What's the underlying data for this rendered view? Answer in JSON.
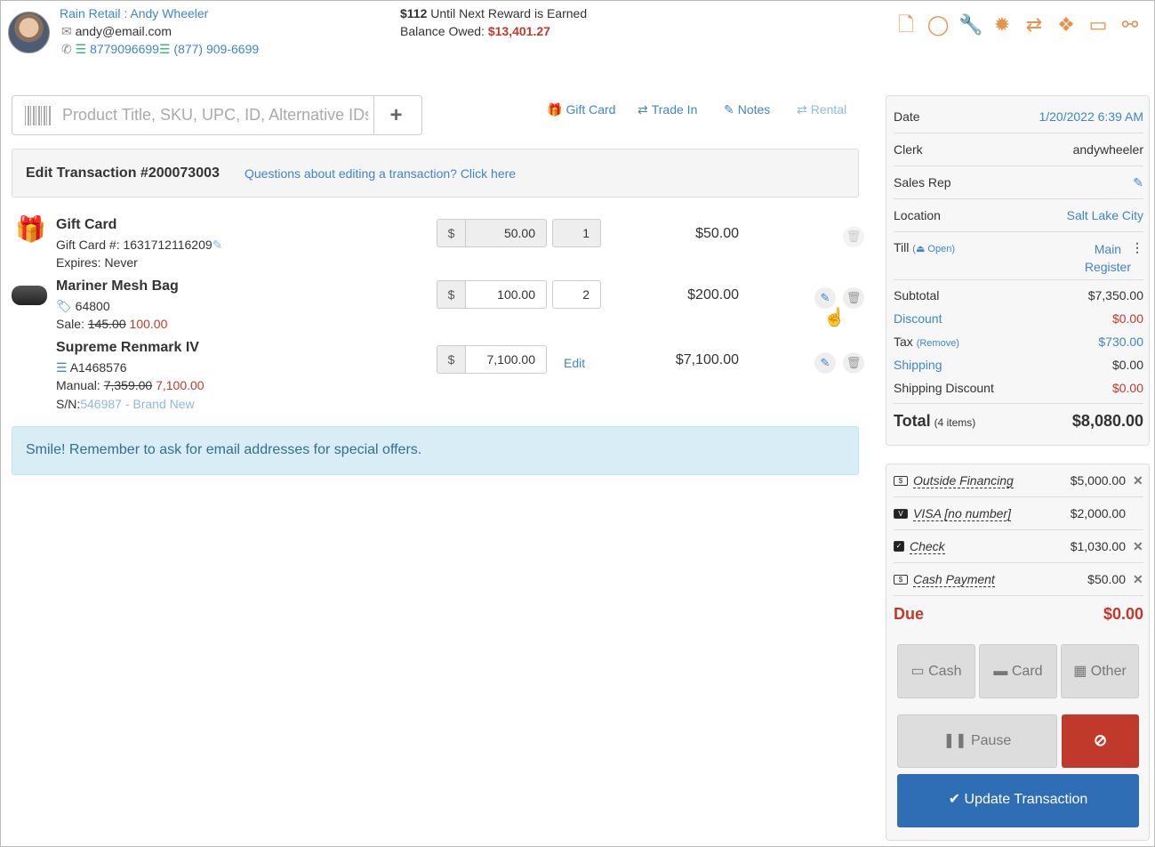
{
  "customer": {
    "store": "Rain Retail",
    "separator": " : ",
    "name": "Andy Wheeler",
    "email": "andy@email.com",
    "phone1": "8779096699",
    "phone2": "(877) 909-6699"
  },
  "rewards": {
    "amount": "$112",
    "text": "Until Next Reward is Earned",
    "balance_label": "Balance Owed: ",
    "balance_value": "$13,401.27"
  },
  "header_icons": [
    "document-icon",
    "chat-icon",
    "wrench-icon",
    "badge-icon",
    "transfer-icon",
    "dropbox-icon",
    "ticket-icon",
    "handshake-icon"
  ],
  "search": {
    "placeholder": "Product Title, SKU, UPC, ID, Alternative IDs",
    "add": "+"
  },
  "tools": {
    "gift_card": "Gift Card",
    "trade_in": "Trade In",
    "notes": "Notes",
    "rental": "Rental"
  },
  "edit": {
    "title": "Edit Transaction #200073003",
    "question": "Questions about editing a transaction? Click here"
  },
  "items": [
    {
      "title": "Gift Card",
      "line1": "Gift Card #: 1631712116209",
      "line2": "Expires: Never",
      "currency": "$",
      "price": "50.00",
      "qty": "1",
      "total": "$50.00"
    },
    {
      "title": "Mariner Mesh Bag",
      "sku": "64800",
      "sale_label": "Sale: ",
      "old_price": "145.00",
      "new_price": "100.00",
      "currency": "$",
      "price": "100.00",
      "qty": "2",
      "total": "$200.00"
    },
    {
      "title": "Supreme Renmark IV",
      "sku": "A1468576",
      "manual_label": "Manual: ",
      "old_price": "7,359.00",
      "new_price": "7,100.00",
      "sn_label": "S/N:",
      "sn_value": "546987 - Brand New",
      "currency": "$",
      "price": "7,100.00",
      "edit": "Edit",
      "total": "$7,100.00"
    }
  ],
  "info_message": "Smile! Remember to ask for email addresses for special offers.",
  "summary": {
    "date_label": "Date",
    "date_value": "1/20/2022 6:39 AM",
    "clerk_label": "Clerk",
    "clerk_value": "andywheeler",
    "rep_label": "Sales Rep",
    "location_label": "Location",
    "location_value": "Salt Lake City",
    "till_label": "Till",
    "till_status": "Open",
    "till_value1": "Main",
    "till_value2": "Register",
    "subtotal_label": "Subtotal",
    "subtotal_value": "$7,350.00",
    "discount_label": "Discount",
    "discount_value": "$0.00",
    "tax_label": "Tax",
    "tax_remove": "(Remove)",
    "tax_value": "$730.00",
    "shipping_label": "Shipping",
    "shipping_value": "$0.00",
    "ship_disc_label": "Shipping Discount",
    "ship_disc_value": "$0.00",
    "total_label": "Total",
    "total_items": "(4 items)",
    "total_value": "$8,080.00"
  },
  "payments": [
    {
      "name": "Outside Financing",
      "amount": "$5,000.00",
      "icon": "cash-icon"
    },
    {
      "name": "VISA [no number]",
      "amount": "$2,000.00",
      "icon": "visa-icon"
    },
    {
      "name": "Check",
      "amount": "$1,030.00",
      "icon": "check-icon"
    },
    {
      "name": "Cash Payment",
      "amount": "$50.00",
      "icon": "cash-icon"
    }
  ],
  "due": {
    "label": "Due",
    "value": "$0.00"
  },
  "buttons": {
    "cash": "Cash",
    "card": "Card",
    "other": "Other",
    "pause": "Pause",
    "update": "Update Transaction"
  }
}
